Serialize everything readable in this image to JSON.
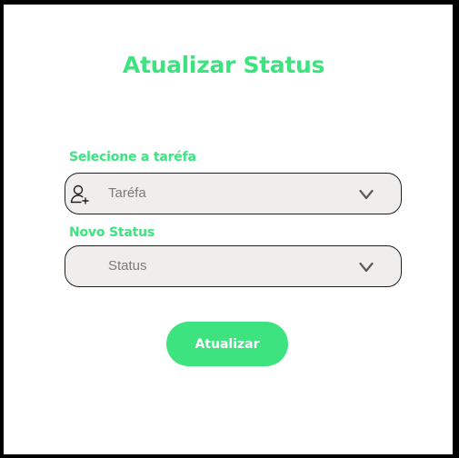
{
  "page": {
    "title": "Atualizar Status"
  },
  "task_field": {
    "label": "Selecione a taréfa",
    "value": "Taréfa",
    "icon": "add-user-icon"
  },
  "status_field": {
    "label": "Novo Status",
    "value": "Status"
  },
  "actions": {
    "submit_label": "Atualizar"
  },
  "colors": {
    "accent": "#3de37e",
    "field_background": "#efeeec",
    "field_text": "#7b7b7b",
    "border": "#1e1e1e"
  }
}
